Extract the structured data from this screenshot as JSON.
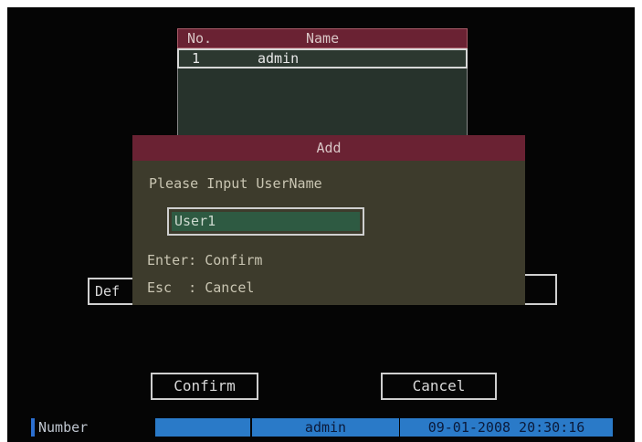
{
  "user_list": {
    "header": {
      "no": "No.",
      "name": "Name"
    },
    "rows": [
      {
        "no": "1",
        "name": "admin"
      }
    ]
  },
  "background_controls": {
    "def_button_label": "Def"
  },
  "dialog": {
    "title": "Add",
    "prompt": "Please Input UserName",
    "username_value": "User1",
    "hint_enter": "Enter: Confirm",
    "hint_esc": "Esc  : Cancel"
  },
  "buttons": {
    "confirm": "Confirm",
    "cancel": "Cancel"
  },
  "status_bar": {
    "label": "Number",
    "user": "admin",
    "datetime": "09-01-2008 20:30:16"
  },
  "colors": {
    "title_bar": "#6a2233",
    "dialog_bg": "#3d3b2c",
    "input_fill": "#2e5a42",
    "status_blue": "#2a7ac8"
  }
}
